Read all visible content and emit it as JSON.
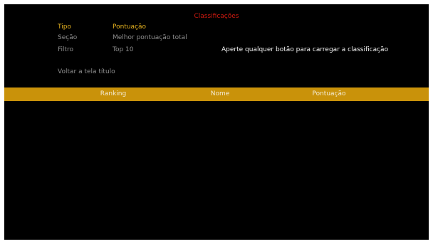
{
  "title": "Classificações",
  "options": [
    {
      "label": "Tipo",
      "value": "Pontuação",
      "active": true
    },
    {
      "label": "Seção",
      "value": "Melhor pontuação total",
      "active": false
    },
    {
      "label": "Filtro",
      "value": "Top 10",
      "active": false
    }
  ],
  "prompt": "Aperte qualquer botão para carregar a classificação",
  "back_label": "Voltar a tela título",
  "table": {
    "columns": [
      "Ranking",
      "Nome",
      "Pontuação"
    ],
    "rows": []
  },
  "colors": {
    "title": "#d01a10",
    "active": "#e8b420",
    "inactive": "#8e8e8e",
    "header_bar": "#c9920a",
    "background": "#000000"
  }
}
